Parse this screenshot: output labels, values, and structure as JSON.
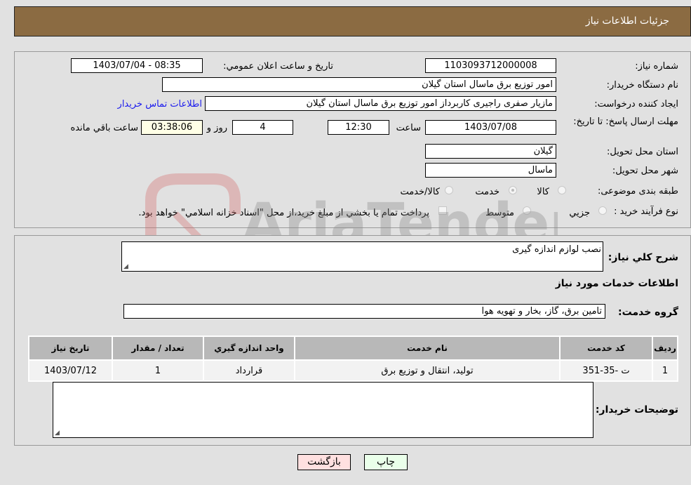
{
  "header": {
    "title": "جزئيات اطلاعات نياز"
  },
  "form": {
    "need_number": {
      "label": "شماره نياز:",
      "value": "1103093712000008"
    },
    "announce_datetime": {
      "label": "تاريخ و ساعت اعلان عمومي:",
      "value": "1403/07/04 - 08:35"
    },
    "buyer_org": {
      "label": "نام دستگاه خريدار:",
      "value": "امور توزیع برق ماسال استان گیلان"
    },
    "requester": {
      "label": "ايجاد كننده درخواست:",
      "value": "مازیار صفری راجیری کاربرداز امور توزیع برق ماسال استان گیلان"
    },
    "contact_link": "اطلاعات تماس خريدار",
    "deadline": {
      "label": "مهلت ارسال پاسخ: تا تاريخ:",
      "date": "1403/07/08",
      "time_label": "ساعت",
      "time": "12:30",
      "days": "4",
      "days_label": "روز و",
      "remaining": "03:38:06",
      "remaining_label": "ساعت باقي مانده"
    },
    "province": {
      "label": "استان محل تحويل:",
      "value": "گیلان"
    },
    "city": {
      "label": "شهر محل تحويل:",
      "value": "ماسال"
    },
    "category": {
      "label": "طبقه بندی موضوعی:",
      "options": [
        "كالا",
        "خدمت",
        "كالا/خدمت"
      ],
      "selected": "خدمت"
    },
    "process": {
      "label": "نوع فرآيند خريد :",
      "options": [
        "جزيي",
        "متوسط"
      ],
      "note": "پرداخت تمام يا بخشي از مبلغ خريد،از محل \"اسناد خزانه اسلامي\" خواهد بود."
    }
  },
  "details": {
    "general_desc_label": "شرح كلي نياز:",
    "general_desc": "نصب لوازم اندازه گیری",
    "services_title": "اطلاعات خدمات مورد نياز",
    "service_group_label": "گروه خدمت:",
    "service_group": "تامين برق، گاز، بخار و تهويه هوا",
    "table": {
      "headers": [
        "رديف",
        "كد خدمت",
        "نام خدمت",
        "واحد اندازه گيري",
        "تعداد / مقدار",
        "تاريخ نياز"
      ],
      "rows": [
        [
          "1",
          "ت -35-351",
          "توليد، انتقال و توزيع برق",
          "قرارداد",
          "1",
          "1403/07/12"
        ]
      ]
    },
    "buyer_notes_label": "توضيحات خريدار:",
    "buyer_notes": ""
  },
  "buttons": {
    "print": "چاپ",
    "back": "بازگشت"
  },
  "watermark": "AriaTender.neT",
  "colors": {
    "header": "#8b6b42",
    "back_btn": "#ffe0e0",
    "print_btn": "#eaffea",
    "link": "#1a1aee"
  }
}
